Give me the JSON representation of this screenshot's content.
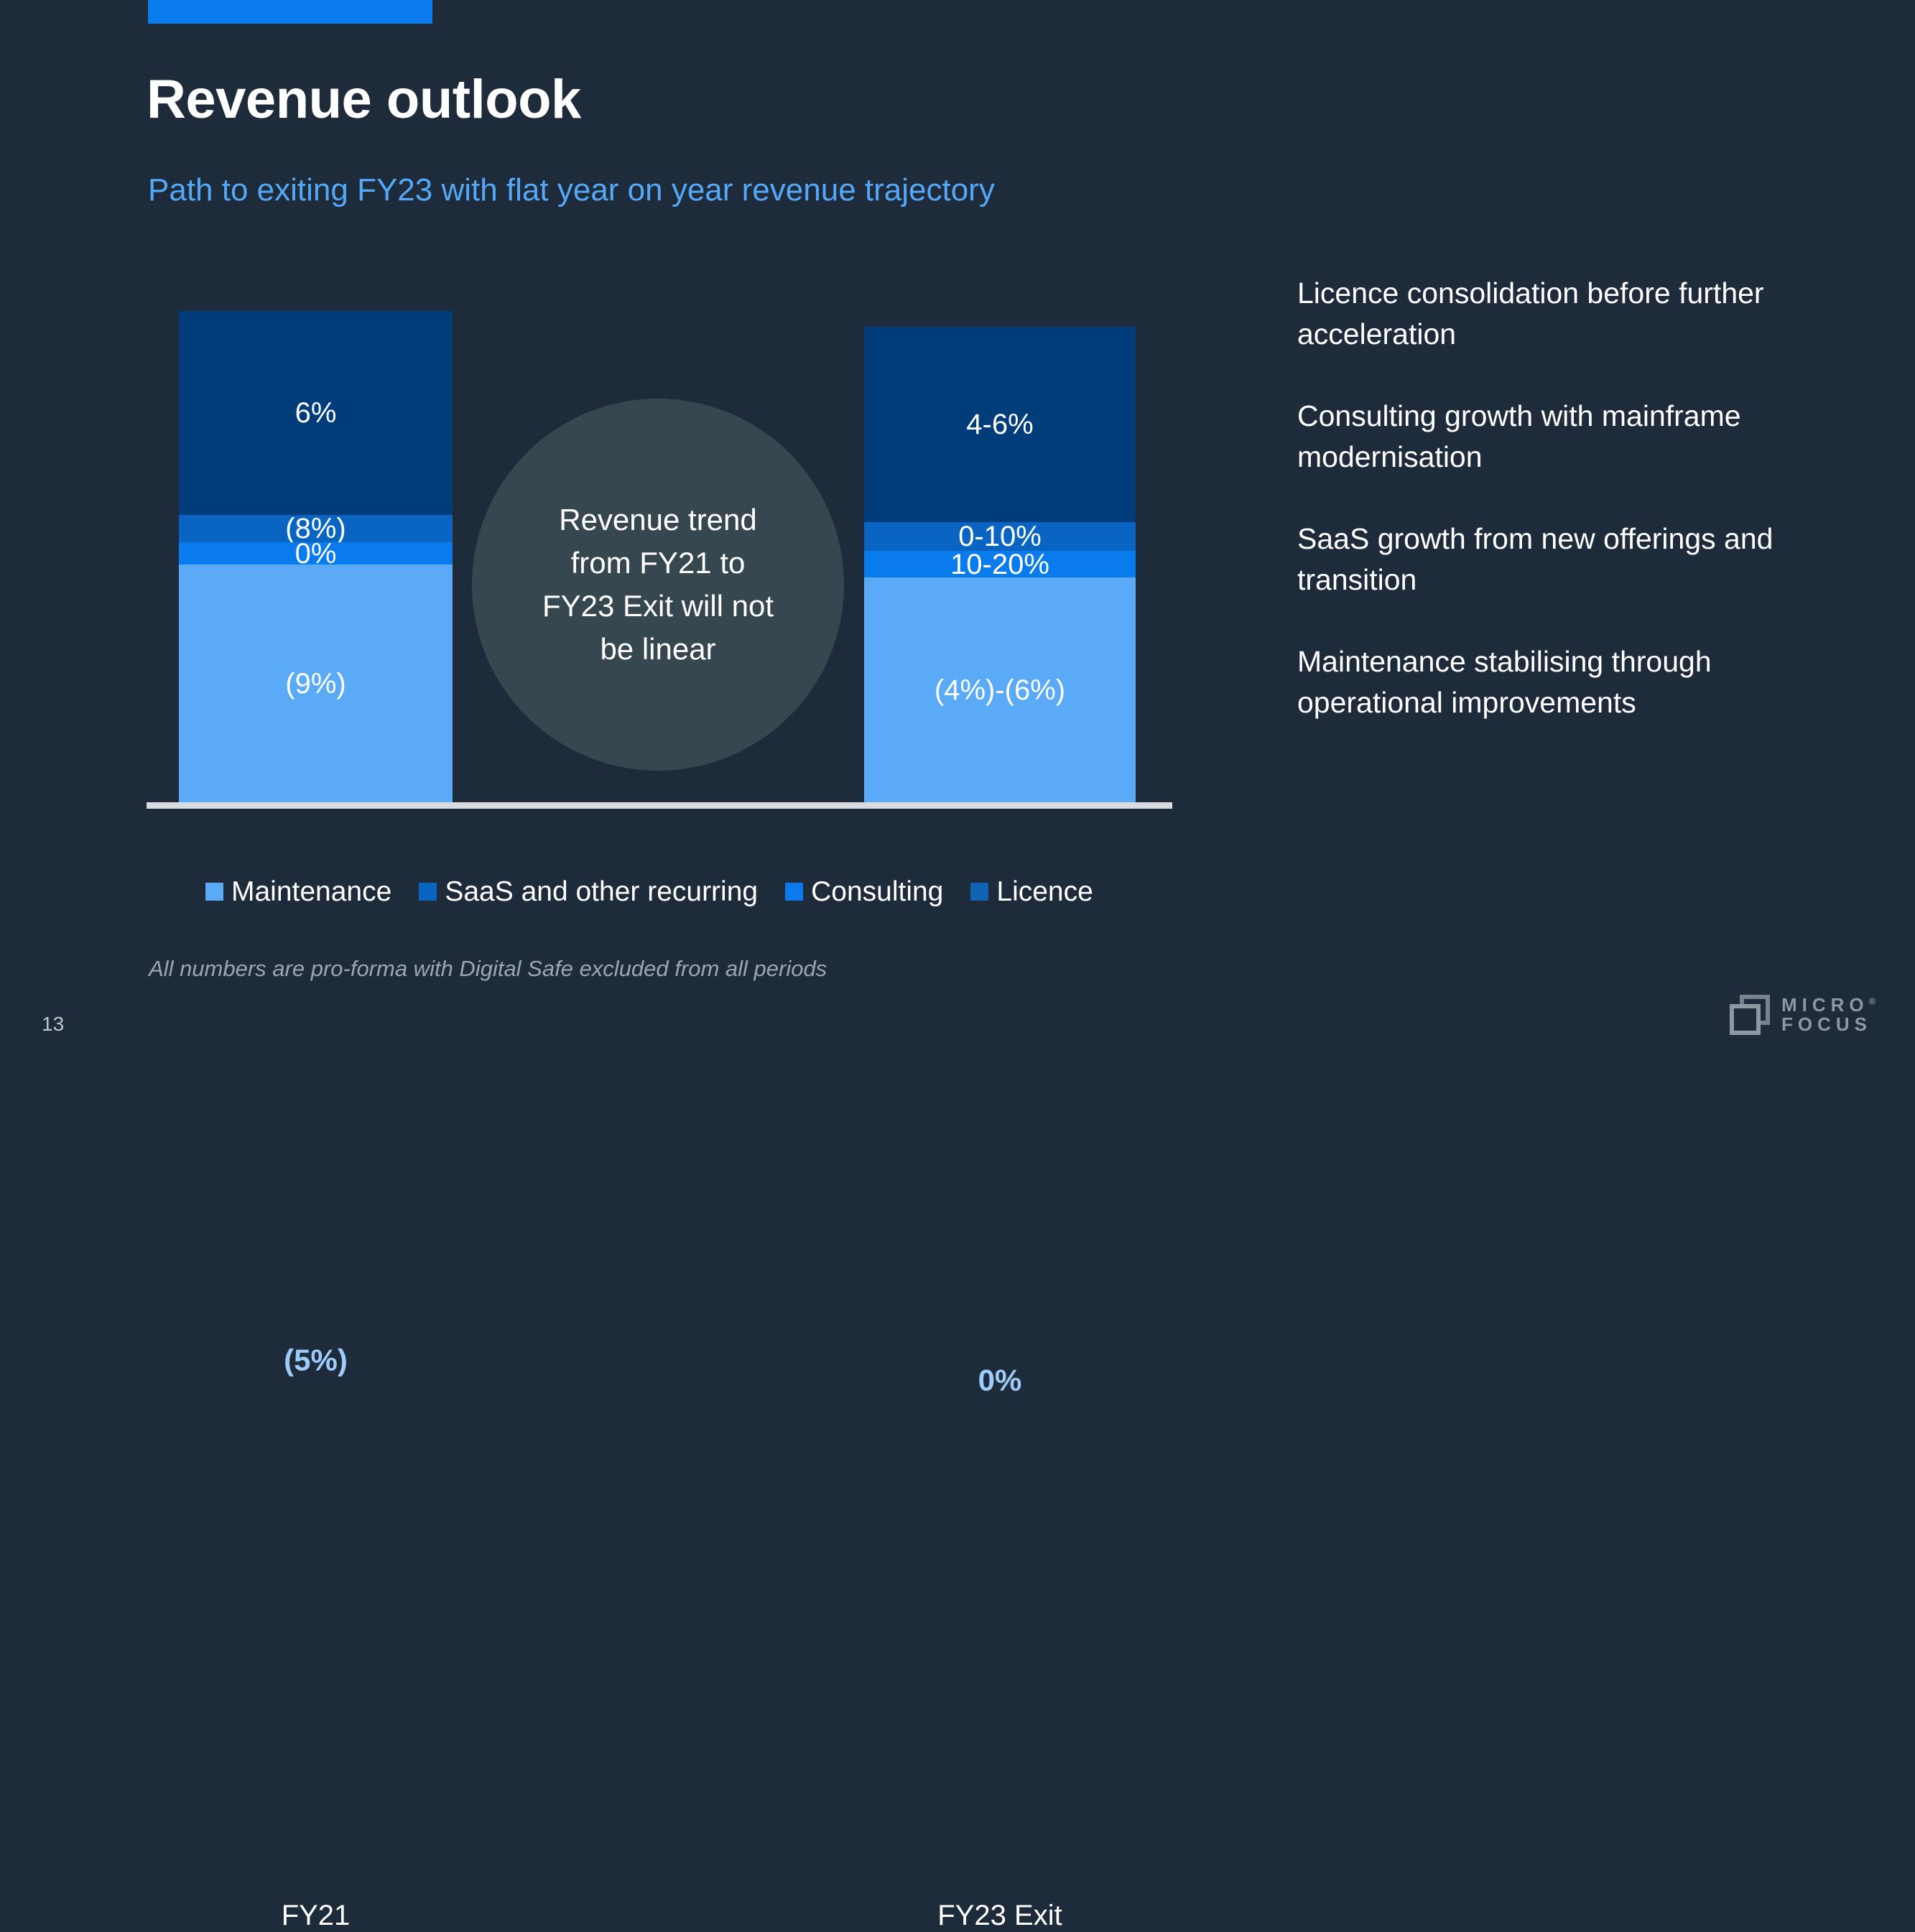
{
  "slide": {
    "title": "Revenue outlook",
    "subtitle": "Path to exiting FY23 with flat year on year revenue trajectory",
    "footnote": "All numbers are pro-forma with Digital Safe excluded from all periods",
    "page_number": "13",
    "accent_color": "#0a7bed",
    "background_color": "#1e2b3a"
  },
  "callout": {
    "text": "Revenue trend from FY21 to FY23 Exit will not be linear",
    "fill_color": "#37474f"
  },
  "chart_data": {
    "type": "bar",
    "stacked": true,
    "title": "",
    "xlabel": "",
    "ylabel": "",
    "grid": false,
    "legend_position": "bottom",
    "categories": [
      "FY21",
      "FY23 Exit"
    ],
    "total_labels": [
      "(5%)",
      "0%"
    ],
    "series": [
      {
        "name": "Maintenance",
        "color": "#5aaaf7",
        "labels": [
          "(9%)",
          "(4%)-(6%)"
        ],
        "values": [
          48.5,
          47.5
        ]
      },
      {
        "name": "SaaS and other recurring",
        "color": "#0a7bed",
        "labels": [
          "0%",
          "10-20%"
        ],
        "values": [
          4.5,
          5.5
        ]
      },
      {
        "name": "Consulting",
        "color": "#0a65c2",
        "labels": [
          "(8%)",
          "0-10%"
        ],
        "values": [
          5.5,
          6.0
        ]
      },
      {
        "name": "Licence",
        "color": "#003d7a",
        "labels": [
          "6%",
          "4-6%"
        ],
        "values": [
          41.5,
          41.0
        ]
      }
    ]
  },
  "notes": [
    "Licence consolidation before further acceleration",
    "Consulting growth with mainframe modernisation",
    "SaaS growth from new offerings and transition",
    "Maintenance stabilising through operational improvements"
  ],
  "logo": {
    "line1": "MICRO",
    "line2": "FOCUS",
    "registered": "®"
  }
}
